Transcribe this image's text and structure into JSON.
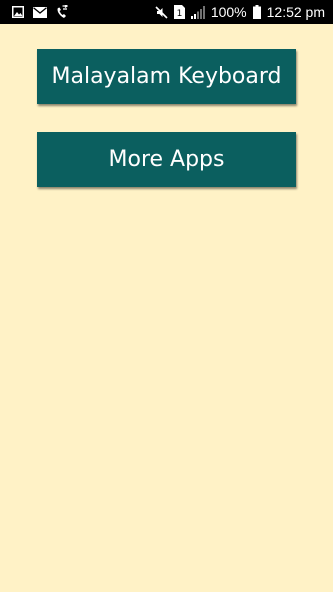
{
  "status_bar": {
    "battery_percent": "100%",
    "time": "12:52 pm",
    "sim_slot": "1",
    "icons": [
      "gallery-icon",
      "email-icon",
      "call-forward-icon",
      "mute-icon",
      "sim-icon",
      "signal-icon",
      "battery-icon"
    ]
  },
  "main": {
    "buttons": [
      {
        "label": "Malayalam Keyboard"
      },
      {
        "label": "More Apps"
      }
    ]
  },
  "colors": {
    "background": "#fff2c6",
    "button": "#0b5f5f",
    "button_text": "#ffffff",
    "status_bar": "#000000"
  }
}
